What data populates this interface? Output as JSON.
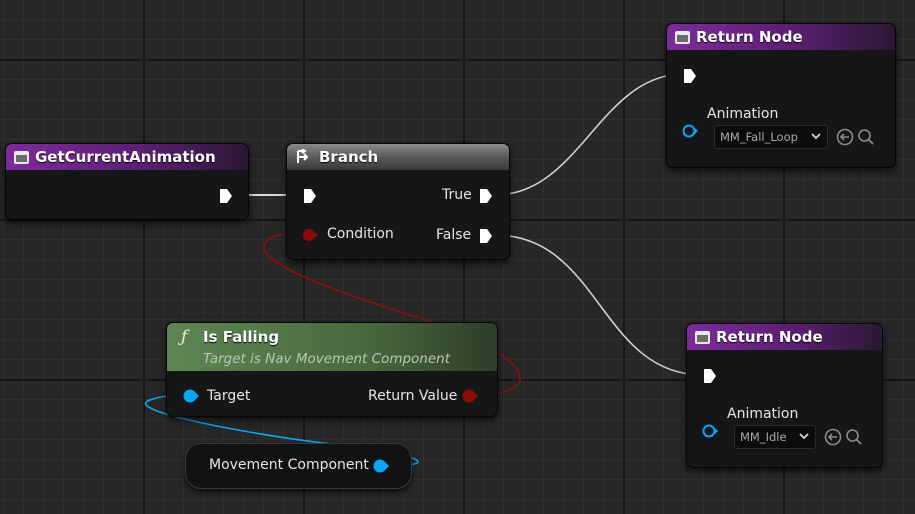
{
  "nodes": {
    "get_current_animation": {
      "title": "GetCurrentAnimation"
    },
    "branch": {
      "title": "Branch",
      "true_label": "True",
      "false_label": "False",
      "condition_label": "Condition"
    },
    "is_falling": {
      "title": "Is Falling",
      "subtitle": "Target is Nav Movement Component",
      "target_label": "Target",
      "return_label": "Return Value",
      "function_glyph": "ƒ"
    },
    "movement_component": {
      "label": "Movement Component"
    },
    "return_node_top": {
      "title": "Return Node",
      "animation_label": "Animation",
      "animation_value": "MM_Fall_Loop"
    },
    "return_node_bottom": {
      "title": "Return Node",
      "animation_label": "Animation",
      "animation_value": "MM_Idle"
    }
  },
  "colors": {
    "exec_pin": "#ffffff",
    "bool_pin": "#8c0a0a",
    "object_pin": "#0aa6f5",
    "function_header": "#7d2b9a",
    "pure_function_header": "#5f8653"
  }
}
